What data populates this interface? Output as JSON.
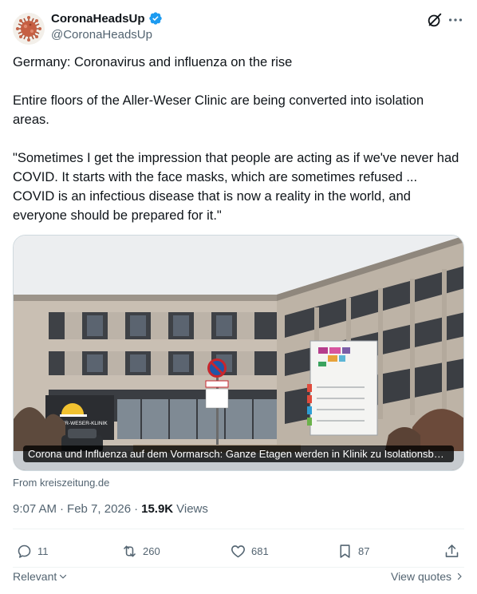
{
  "author": {
    "display_name": "CoronaHeadsUp",
    "handle": "@CoronaHeadsUp",
    "verified": true,
    "avatar_icon": "coronavirus-avatar",
    "verified_color": "#1d9bf0"
  },
  "tweet": {
    "paragraphs": [
      "Germany: Coronavirus and influenza on the rise",
      "Entire floors of the Aller-Weser Clinic are being converted into isolation areas.",
      "\"Sometimes I get the impression that people are acting as if we've never had COVID. It starts with the face masks, which are sometimes refused ... COVID is an  infectious disease that is now a reality in the world, and everyone  should be prepared for it.\""
    ]
  },
  "media": {
    "caption": "Corona und Influenza auf dem Vormarsch: Ganze Etagen werden in Klinik zu Isolationsber...",
    "sign_text": "ALLER-WESER-KLINIK",
    "source": "From kreiszeitung.de"
  },
  "meta": {
    "time": "9:07 AM",
    "separator": "·",
    "date": "Feb 7, 2026",
    "views_count": "15.9K",
    "views_label": "Views"
  },
  "actions": {
    "replies": "11",
    "reposts": "260",
    "likes": "681",
    "bookmarks": "87"
  },
  "footer": {
    "sort_label": "Relevant",
    "view_quotes_label": "View quotes"
  },
  "colors": {
    "text_primary": "#0f1419",
    "text_secondary": "#536471",
    "border": "#cfd9de"
  }
}
